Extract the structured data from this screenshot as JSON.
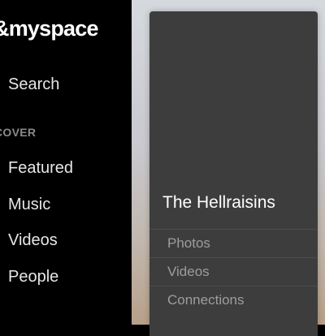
{
  "sidebar": {
    "logo": "myspace",
    "search_label": "Search",
    "section_heading": "COVER",
    "nav_items": [
      "Featured",
      "Music",
      "Videos",
      "People"
    ]
  },
  "panel": {
    "title": "The Hellraisins",
    "menu_items": [
      "Photos",
      "Videos",
      "Connections"
    ]
  },
  "colors": {
    "sidebar_bg": "#000000",
    "panel_bg": "#3d3d3d",
    "muted_text": "#9d9d9d"
  }
}
